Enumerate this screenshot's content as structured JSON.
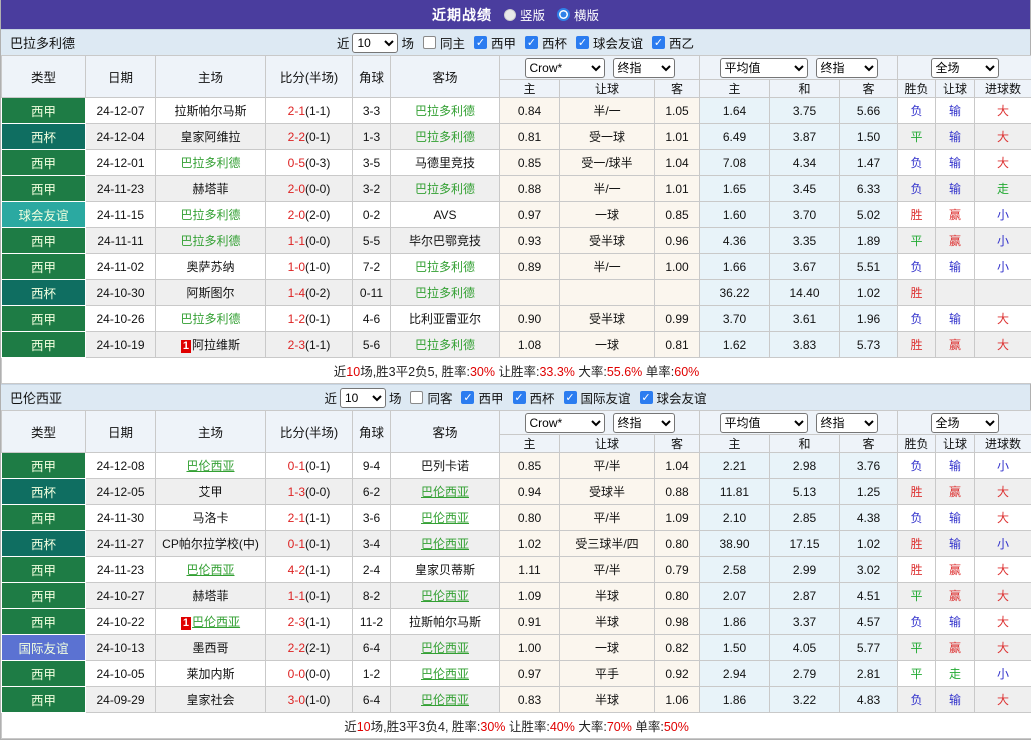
{
  "topbar": {
    "title": "近期战绩",
    "radios": [
      {
        "label": "竖版",
        "selected": false
      },
      {
        "label": "横版",
        "selected": true
      }
    ]
  },
  "table_header": {
    "cols_left": [
      "类型",
      "日期",
      "主场",
      "比分(半场)",
      "角球",
      "客场"
    ],
    "dropdowns": {
      "odds_source": "Crow*",
      "odds_final1": "终指",
      "average": "平均值",
      "odds_final2": "终指",
      "fulltime": "全场"
    },
    "cols_sub": [
      "主",
      "让球",
      "客",
      "主",
      "和",
      "客",
      "胜负",
      "让球",
      "进球数"
    ]
  },
  "colors": {
    "topbar_bg": "#4a3d9e",
    "filterbar_bg": "#dde9f3",
    "type_badges": {
      "西甲": "#1e7c45",
      "西杯": "#0f6e61",
      "球会友谊": "#2ba9a1",
      "国际友谊": "#5b72d2"
    },
    "badge_text": "#f2ffdf",
    "focus_team": "#33a033",
    "score_red": "#dd2222",
    "result": {
      "胜": "#dd3333",
      "赢": "#dd3333",
      "大": "#dd3333",
      "负": "#3333cc",
      "输": "#3333cc",
      "小": "#3333cc",
      "平": "#22aa33",
      "走": "#22aa33"
    }
  },
  "sections": [
    {
      "team": "巴拉多利德",
      "focus_underline": false,
      "filter": {
        "near_label": "近",
        "count": "10",
        "games_label": "场",
        "same_label": "同主",
        "leagues": [
          "西甲",
          "西杯",
          "球会友谊",
          "西乙"
        ]
      },
      "rows": [
        {
          "type": "西甲",
          "date": "24-12-07",
          "home": "拉斯帕尔马斯",
          "score": "2-1",
          "half": "(1-1)",
          "corner": "3-3",
          "away": "巴拉多利德",
          "oh": "0.84",
          "hd": "半/一",
          "oa": "1.05",
          "ah": "1.64",
          "ad": "3.75",
          "aa": "5.66",
          "r1": "负",
          "r2": "输",
          "r3": "大"
        },
        {
          "type": "西杯",
          "date": "24-12-04",
          "home": "皇家阿维拉",
          "score": "2-2",
          "half": "(0-1)",
          "corner": "1-3",
          "away": "巴拉多利德",
          "oh": "0.81",
          "hd": "受一球",
          "oa": "1.01",
          "ah": "6.49",
          "ad": "3.87",
          "aa": "1.50",
          "r1": "平",
          "r2": "输",
          "r3": "大"
        },
        {
          "type": "西甲",
          "date": "24-12-01",
          "home": "巴拉多利德",
          "score": "0-5",
          "half": "(0-3)",
          "corner": "3-5",
          "away": "马德里竞技",
          "oh": "0.85",
          "hd": "受一/球半",
          "oa": "1.04",
          "ah": "7.08",
          "ad": "4.34",
          "aa": "1.47",
          "r1": "负",
          "r2": "输",
          "r3": "大"
        },
        {
          "type": "西甲",
          "date": "24-11-23",
          "home": "赫塔菲",
          "score": "2-0",
          "half": "(0-0)",
          "corner": "3-2",
          "away": "巴拉多利德",
          "oh": "0.88",
          "hd": "半/一",
          "oa": "1.01",
          "ah": "1.65",
          "ad": "3.45",
          "aa": "6.33",
          "r1": "负",
          "r2": "输",
          "r3": "走"
        },
        {
          "type": "球会友谊",
          "date": "24-11-15",
          "home": "巴拉多利德",
          "score": "2-0",
          "half": "(2-0)",
          "corner": "0-2",
          "away": "AVS",
          "oh": "0.97",
          "hd": "一球",
          "oa": "0.85",
          "ah": "1.60",
          "ad": "3.70",
          "aa": "5.02",
          "r1": "胜",
          "r2": "赢",
          "r3": "小"
        },
        {
          "type": "西甲",
          "date": "24-11-11",
          "home": "巴拉多利德",
          "score": "1-1",
          "half": "(0-0)",
          "corner": "5-5",
          "away": "毕尔巴鄂竞技",
          "oh": "0.93",
          "hd": "受半球",
          "oa": "0.96",
          "ah": "4.36",
          "ad": "3.35",
          "aa": "1.89",
          "r1": "平",
          "r2": "赢",
          "r3": "小"
        },
        {
          "type": "西甲",
          "date": "24-11-02",
          "home": "奥萨苏纳",
          "score": "1-0",
          "half": "(1-0)",
          "corner": "7-2",
          "away": "巴拉多利德",
          "oh": "0.89",
          "hd": "半/一",
          "oa": "1.00",
          "ah": "1.66",
          "ad": "3.67",
          "aa": "5.51",
          "r1": "负",
          "r2": "输",
          "r3": "小"
        },
        {
          "type": "西杯",
          "date": "24-10-30",
          "home": "阿斯图尔",
          "score": "1-4",
          "half": "(0-2)",
          "corner": "0-11",
          "away": "巴拉多利德",
          "oh": "",
          "hd": "",
          "oa": "",
          "ah": "36.22",
          "ad": "14.40",
          "aa": "1.02",
          "r1": "胜",
          "r2": "",
          "r3": ""
        },
        {
          "type": "西甲",
          "date": "24-10-26",
          "home": "巴拉多利德",
          "score": "1-2",
          "half": "(0-1)",
          "corner": "4-6",
          "away": "比利亚雷亚尔",
          "oh": "0.90",
          "hd": "受半球",
          "oa": "0.99",
          "ah": "3.70",
          "ad": "3.61",
          "aa": "1.96",
          "r1": "负",
          "r2": "输",
          "r3": "大"
        },
        {
          "type": "西甲",
          "date": "24-10-19",
          "home": "阿拉维斯",
          "home_card": "1",
          "score": "2-3",
          "half": "(1-1)",
          "corner": "5-6",
          "away": "巴拉多利德",
          "oh": "1.08",
          "hd": "一球",
          "oa": "0.81",
          "ah": "1.62",
          "ad": "3.83",
          "aa": "5.73",
          "r1": "胜",
          "r2": "赢",
          "r3": "大"
        }
      ],
      "summary": {
        "near": "近",
        "count": "10",
        "mid": "场,胜3平2负5, ",
        "stats": [
          [
            "胜率:",
            "30%"
          ],
          [
            "让胜率:",
            "33.3%"
          ],
          [
            "大率:",
            "55.6%"
          ],
          [
            "单率:",
            "60%"
          ]
        ]
      }
    },
    {
      "team": "巴伦西亚",
      "focus_underline": true,
      "filter": {
        "near_label": "近",
        "count": "10",
        "games_label": "场",
        "same_label": "同客",
        "leagues": [
          "西甲",
          "西杯",
          "国际友谊",
          "球会友谊"
        ]
      },
      "rows": [
        {
          "type": "西甲",
          "date": "24-12-08",
          "home": "巴伦西亚",
          "score": "0-1",
          "half": "(0-1)",
          "corner": "9-4",
          "away": "巴列卡诺",
          "oh": "0.85",
          "hd": "平/半",
          "oa": "1.04",
          "ah": "2.21",
          "ad": "2.98",
          "aa": "3.76",
          "r1": "负",
          "r2": "输",
          "r3": "小"
        },
        {
          "type": "西杯",
          "date": "24-12-05",
          "home": "艾甲",
          "score": "1-3",
          "half": "(0-0)",
          "corner": "6-2",
          "away": "巴伦西亚",
          "oh": "0.94",
          "hd": "受球半",
          "oa": "0.88",
          "ah": "11.81",
          "ad": "5.13",
          "aa": "1.25",
          "r1": "胜",
          "r2": "赢",
          "r3": "大"
        },
        {
          "type": "西甲",
          "date": "24-11-30",
          "home": "马洛卡",
          "score": "2-1",
          "half": "(1-1)",
          "corner": "3-6",
          "away": "巴伦西亚",
          "oh": "0.80",
          "hd": "平/半",
          "oa": "1.09",
          "ah": "2.10",
          "ad": "2.85",
          "aa": "4.38",
          "r1": "负",
          "r2": "输",
          "r3": "大"
        },
        {
          "type": "西杯",
          "date": "24-11-27",
          "home": "CP帕尔拉学校(中)",
          "score": "0-1",
          "half": "(0-1)",
          "corner": "3-4",
          "away": "巴伦西亚",
          "oh": "1.02",
          "hd": "受三球半/四",
          "oa": "0.80",
          "ah": "38.90",
          "ad": "17.15",
          "aa": "1.02",
          "r1": "胜",
          "r2": "输",
          "r3": "小"
        },
        {
          "type": "西甲",
          "date": "24-11-23",
          "home": "巴伦西亚",
          "score": "4-2",
          "half": "(1-1)",
          "corner": "2-4",
          "away": "皇家贝蒂斯",
          "oh": "1.11",
          "hd": "平/半",
          "oa": "0.79",
          "ah": "2.58",
          "ad": "2.99",
          "aa": "3.02",
          "r1": "胜",
          "r2": "赢",
          "r3": "大"
        },
        {
          "type": "西甲",
          "date": "24-10-27",
          "home": "赫塔菲",
          "score": "1-1",
          "half": "(0-1)",
          "corner": "8-2",
          "away": "巴伦西亚",
          "oh": "1.09",
          "hd": "半球",
          "oa": "0.80",
          "ah": "2.07",
          "ad": "2.87",
          "aa": "4.51",
          "r1": "平",
          "r2": "赢",
          "r3": "大"
        },
        {
          "type": "西甲",
          "date": "24-10-22",
          "home": "巴伦西亚",
          "home_card": "1",
          "score": "2-3",
          "half": "(1-1)",
          "corner": "11-2",
          "away": "拉斯帕尔马斯",
          "oh": "0.91",
          "hd": "半球",
          "oa": "0.98",
          "ah": "1.86",
          "ad": "3.37",
          "aa": "4.57",
          "r1": "负",
          "r2": "输",
          "r3": "大"
        },
        {
          "type": "国际友谊",
          "date": "24-10-13",
          "home": "墨西哥",
          "score": "2-2",
          "half": "(2-1)",
          "corner": "6-4",
          "away": "巴伦西亚",
          "oh": "1.00",
          "hd": "一球",
          "oa": "0.82",
          "ah": "1.50",
          "ad": "4.05",
          "aa": "5.77",
          "r1": "平",
          "r2": "赢",
          "r3": "大"
        },
        {
          "type": "西甲",
          "date": "24-10-05",
          "home": "莱加内斯",
          "score": "0-0",
          "half": "(0-0)",
          "corner": "1-2",
          "away": "巴伦西亚",
          "oh": "0.97",
          "hd": "平手",
          "oa": "0.92",
          "ah": "2.94",
          "ad": "2.79",
          "aa": "2.81",
          "r1": "平",
          "r2": "走",
          "r3": "小"
        },
        {
          "type": "西甲",
          "date": "24-09-29",
          "home": "皇家社会",
          "score": "3-0",
          "half": "(1-0)",
          "corner": "6-4",
          "away": "巴伦西亚",
          "oh": "0.83",
          "hd": "半球",
          "oa": "1.06",
          "ah": "1.86",
          "ad": "3.22",
          "aa": "4.83",
          "r1": "负",
          "r2": "输",
          "r3": "大"
        }
      ],
      "summary": {
        "near": "近",
        "count": "10",
        "mid": "场,胜3平3负4, ",
        "stats": [
          [
            "胜率:",
            "30%"
          ],
          [
            "让胜率:",
            "40%"
          ],
          [
            "大率:",
            "70%"
          ],
          [
            "单率:",
            "50%"
          ]
        ]
      }
    }
  ]
}
